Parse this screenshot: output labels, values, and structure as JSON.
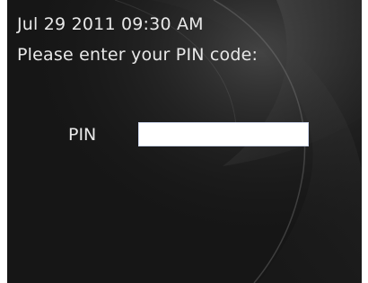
{
  "status": {
    "datetime": "Jul 29 2011 09:30 AM"
  },
  "prompt": {
    "text": "Please enter your PIN code:"
  },
  "pin": {
    "label": "PIN",
    "value": "",
    "placeholder": ""
  },
  "theme": {
    "background": "#161616",
    "text_color": "#e8e8e8",
    "input_background": "#ffffff"
  }
}
